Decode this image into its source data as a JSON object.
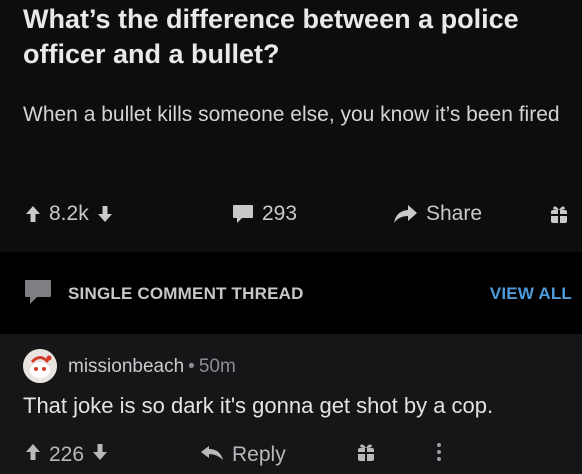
{
  "post": {
    "title": "What’s the difference between a police officer and a bullet?",
    "body": "When a bullet kills someone else, you know it’s been fired",
    "score": "8.2k",
    "comments": "293",
    "share_label": "Share"
  },
  "thread_bar": {
    "label": "SINGLE COMMENT THREAD",
    "view_all": "VIEW ALL"
  },
  "comment": {
    "username": "missionbeach",
    "separator": "•",
    "age": "50m",
    "text": "That joke is so dark it's gonna get shot by a cop.",
    "score": "226",
    "reply_label": "Reply"
  },
  "icons": {
    "upvote": "arrow-up-icon",
    "downvote": "arrow-down-icon",
    "comment": "speech-bubble-icon",
    "share": "share-arrow-icon",
    "award": "gift-icon",
    "reply": "reply-arrow-icon",
    "more": "more-vertical-icon"
  },
  "colors": {
    "accent_link": "#4f9bd9",
    "background": "#0b0b0c",
    "comment_bg": "#161619"
  }
}
